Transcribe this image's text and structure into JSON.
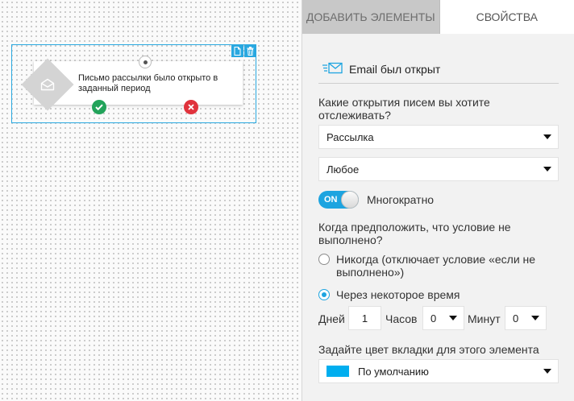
{
  "canvas": {
    "node": {
      "text": "Письмо рассылки было открыто в заданный период"
    }
  },
  "tabs": {
    "add_elements": "Добавить элементы",
    "properties": "Свойства"
  },
  "properties": {
    "element_title": "Email был открыт",
    "question_opens": "Какие открытия писем вы хотите отслеживать?",
    "opens_type_value": "Рассылка",
    "opens_scope_value": "Любое",
    "toggle_label": "ON",
    "repeat_label": "Многократно",
    "question_unfulfilled": "Когда предположить, что условие не выполнено?",
    "option_never": "Никогда (отключает условие «если не выполнено»)",
    "option_after_time": "Через некоторое время",
    "days_label": "Дней",
    "days_value": "1",
    "hours_label": "Часов",
    "hours_value": "0",
    "minutes_label": "Минут",
    "minutes_value": "0",
    "tab_color_label": "Задайте цвет вкладки для этого элемента",
    "tab_color_value": "По умолчанию",
    "tab_color_swatch": "#00aeef"
  },
  "colors": {
    "accent": "#1da4e0",
    "success": "#22a35a",
    "danger": "#e0323c"
  }
}
